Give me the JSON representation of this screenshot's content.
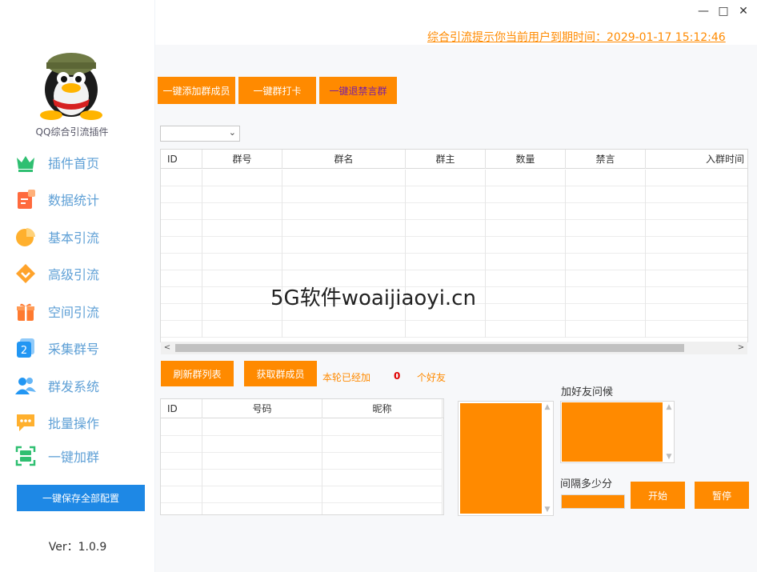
{
  "window": {
    "minimize_glyph": "—",
    "maximize_glyph": "□",
    "close_glyph": "✕"
  },
  "notice": {
    "text": "综合引流提示你当前用户到期时间：2029-01-17 15:12:46"
  },
  "sidebar": {
    "app_name": "QQ综合引流插件",
    "items": [
      {
        "label": "插件首页",
        "icon": "crown-icon",
        "color": "#2fbf71"
      },
      {
        "label": "数据统计",
        "icon": "report-icon",
        "color": "#ff6a3d"
      },
      {
        "label": "基本引流",
        "icon": "pie-chart-icon",
        "color": "#ffb02e"
      },
      {
        "label": "高级引流",
        "icon": "diamond-icon",
        "color": "#ffa32b"
      },
      {
        "label": "空间引流",
        "icon": "gift-icon",
        "color": "#ff7a30"
      },
      {
        "label": "采集群号",
        "icon": "number-two-icon",
        "color": "#2196f3"
      },
      {
        "label": "群发系统",
        "icon": "users-icon",
        "color": "#2196f3"
      },
      {
        "label": "批量操作",
        "icon": "chat-bubble-icon",
        "color": "#ffb02e"
      },
      {
        "label": "一键加群",
        "icon": "scan-frame-icon",
        "color": "#2fbf71"
      }
    ],
    "save_button": "一键保存全部配置",
    "version": "Ver：1.0.9"
  },
  "actions": {
    "add_members": "一键添加群成员",
    "checkin": "一键群打卡",
    "exit_muted": "一键退禁言群"
  },
  "group_table": {
    "columns": [
      "ID",
      "群号",
      "群名",
      "群主",
      "数量",
      "禁言",
      "入群时间"
    ]
  },
  "member_controls": {
    "refresh_list": "刷新群列表",
    "fetch_members": "获取群成员",
    "added_prefix": "本轮已经加",
    "added_count": "0",
    "added_suffix": "个好友"
  },
  "member_table": {
    "columns": [
      "ID",
      "号码",
      "昵称"
    ]
  },
  "friend_panel": {
    "greeting_label": "加好友问候",
    "interval_label": "间隔多少分",
    "start_button": "开始",
    "pause_button": "暂停"
  },
  "watermark": "5G软件woaijiaoyi.cn",
  "colors": {
    "accent": "#ff8a00",
    "primary": "#1e88e5",
    "nav_text": "#5fa0d6"
  }
}
